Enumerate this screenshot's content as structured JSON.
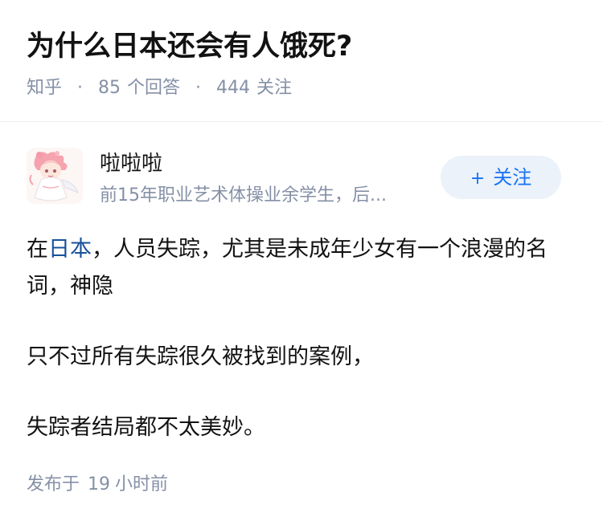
{
  "question": {
    "title": "为什么日本还会有人饿死?",
    "source": "知乎",
    "separator": "·",
    "answer_count": "85",
    "answer_label": "个回答",
    "follower_count": "444",
    "follower_label": "关注"
  },
  "author": {
    "name": "啦啦啦",
    "bio": "前15年职业艺术体操业余学生，后...",
    "avatar_icon": "anime-girl-avatar-icon",
    "follow_label": "关注",
    "follow_icon": "plus-icon"
  },
  "answer": {
    "p1_prefix": "在",
    "p1_link": "日本",
    "p1_rest": "，人员失踪，尤其是未成年少女有一个浪漫的名词，神隐",
    "p2": "只不过所有失踪很久被找到的案例，",
    "p3": "失踪者结局都不太美妙。",
    "link_color": "#175199"
  },
  "footer": {
    "published_label": "发布于",
    "time_value": "19",
    "time_unit": "小时前"
  },
  "colors": {
    "text": "#121212",
    "meta": "#8590a6",
    "accent": "#1772f6",
    "button_bg": "#ebf2fa"
  }
}
